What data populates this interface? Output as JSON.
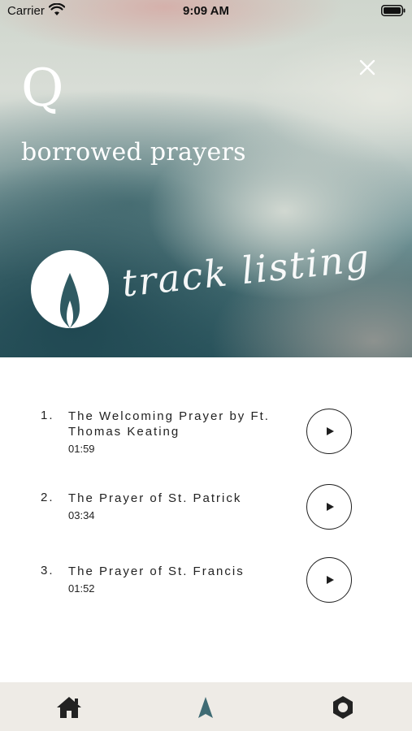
{
  "status_bar": {
    "carrier": "Carrier",
    "time": "9:09 AM"
  },
  "header": {
    "logo_letter": "Q",
    "title": "borrowed prayers",
    "script_title": "track listing",
    "close_icon": "close-icon"
  },
  "tracks": [
    {
      "number": "1.",
      "title": "The Welcoming Prayer by Ft. Thomas Keating",
      "duration": "01:59"
    },
    {
      "number": "2.",
      "title": "The Prayer of St. Patrick",
      "duration": "03:34"
    },
    {
      "number": "3.",
      "title": "The Prayer of St. Francis",
      "duration": "01:52"
    }
  ],
  "tab_bar": {
    "items": [
      {
        "icon": "home-icon",
        "active": false
      },
      {
        "icon": "flame-icon",
        "active": true
      },
      {
        "icon": "settings-icon",
        "active": false
      }
    ]
  },
  "colors": {
    "tab_bar_bg": "#eeebe6",
    "active_tab": "#3f6b74",
    "inactive_tab": "#222222",
    "hero_teal": "#2f5a62"
  }
}
